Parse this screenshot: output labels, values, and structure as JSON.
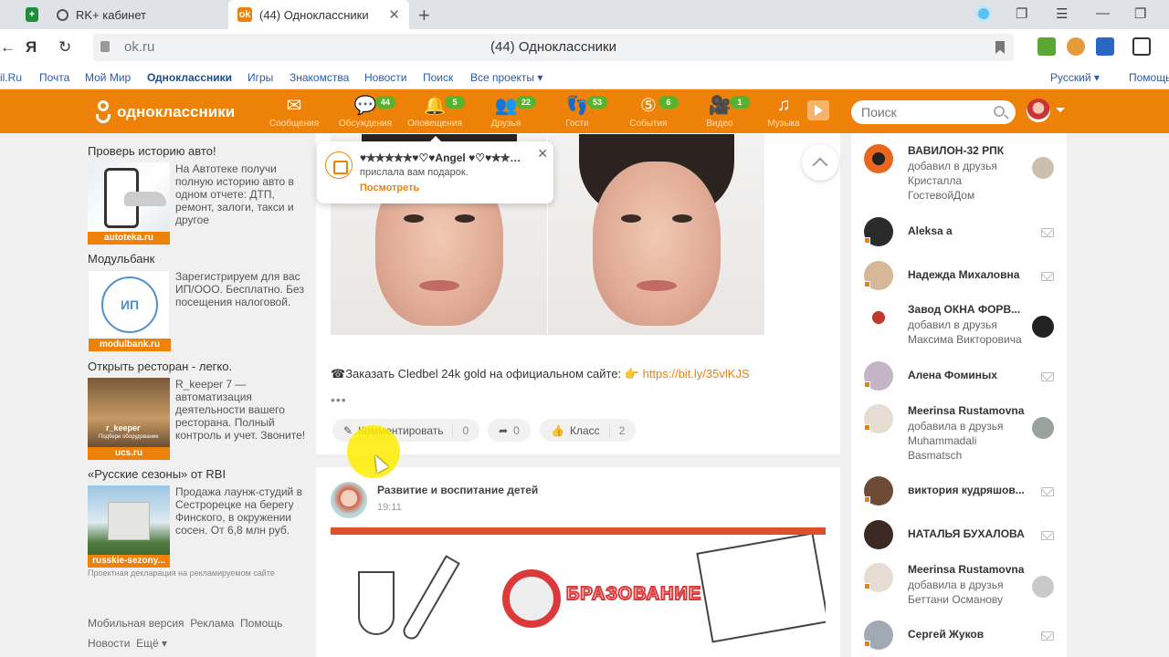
{
  "browser": {
    "tabs": [
      {
        "label": "RK+ кабинет",
        "active": false
      },
      {
        "label": "(44) Одноклассники",
        "active": true
      }
    ],
    "host": "ok.ru",
    "page_title": "(44) Одноклассники",
    "bookmarks_left_stub": "il.Ru",
    "bookmarks": [
      "Почта",
      "Мой Мир",
      "Одноклассники",
      "Игры",
      "Знакомства",
      "Новости",
      "Поиск",
      "Все проекты ▾"
    ],
    "language": "Русский ▾",
    "help": "Помощь"
  },
  "header": {
    "logo": "одноклассники",
    "nav": [
      {
        "label": "Сообщения",
        "icon": "envelope-icon",
        "badge": ""
      },
      {
        "label": "Обсуждения",
        "icon": "chat-bubble-icon",
        "badge": "44"
      },
      {
        "label": "Оповещения",
        "icon": "bell-icon",
        "badge": "5"
      },
      {
        "label": "Друзья",
        "icon": "friends-icon",
        "badge": "22"
      },
      {
        "label": "Гости",
        "icon": "footprints-icon",
        "badge": "53"
      },
      {
        "label": "События",
        "icon": "events-icon",
        "badge": "6"
      },
      {
        "label": "Видео",
        "icon": "video-camera-icon",
        "badge": "1"
      },
      {
        "label": "Музыка",
        "icon": "music-note-icon",
        "badge": ""
      }
    ],
    "search_placeholder": "Поиск",
    "brand_color": "#ee8208",
    "badge_color": "#59b22c"
  },
  "ads": [
    {
      "title": "Проверь историю авто!",
      "text": "На Автотеке получи полную историю авто в одном отчете: ДТП, ремонт, залоги, такси и другое",
      "caption": "autoteka.ru"
    },
    {
      "title": "Модульбанк",
      "text": "Зарегистрируем для вас ИП/ООО. Бесплатно. Без посещения налоговой.",
      "caption": "modulbank.ru",
      "logo_text": "ИП"
    },
    {
      "title": "Открыть ресторан - легко.",
      "text": "R_keeper 7 — автоматизация деятельности вашего ресторана. Полный контроль и учет. Звоните!",
      "caption": "ucs.ru",
      "img_text": "r_keeper",
      "img_sub": "Подбери оборудование"
    },
    {
      "title": "«Русские сезоны» от RBI",
      "text": "Продажа лаунж-студий в Сестрорецке на берегу Финского, в окружении сосен. От 6,8 млн руб.",
      "caption": "russkie-sezony..."
    }
  ],
  "disclaimer": "Проектная декларация на рекламируемом сайте",
  "footer": {
    "row1": [
      "Мобильная версия",
      "Реклама",
      "Помощь"
    ],
    "row2": [
      "Новости",
      "Ещё ▾"
    ]
  },
  "notification": {
    "sender": "♥✯✯✯✯✯♥♡♥Angel ♥♡♥✯✯✯✯...",
    "text": "прислала вам подарок.",
    "action": "Посмотреть"
  },
  "post": {
    "text_prefix": "☎Заказать Cledbel 24k gold на официальном сайте: 👉 ",
    "link": "https://bit.ly/35vlKJS",
    "more": "•••",
    "comment_label": "Комментировать",
    "comment_count": "0",
    "share_count": "0",
    "like_label": "Класс",
    "like_count": "2"
  },
  "post2": {
    "group": "Развитие и воспитание детей",
    "time": "19:11",
    "banner_word": "БРАЗОВАНИЕ"
  },
  "friends": [
    {
      "name": "ВАВИЛОН-32 РПК",
      "sub": "добавил в друзья Кристалла ГостевойДом",
      "type": "thumb"
    },
    {
      "name": "Aleksa a",
      "sub": "",
      "type": "mail"
    },
    {
      "name": "Надежда Михаловна",
      "sub": "",
      "type": "mail"
    },
    {
      "name": "Завод ОКНА ФОРВ...",
      "sub": "добавил в друзья Максима Викторовича",
      "type": "thumb"
    },
    {
      "name": "Алена Фоминых",
      "sub": "",
      "type": "mail"
    },
    {
      "name": "Meerinsa Rustamovna",
      "sub": "добавила в друзья Muhammadali Basmatsch",
      "type": "thumb"
    },
    {
      "name": "виктория кудряшов...",
      "sub": "",
      "type": "mail"
    },
    {
      "name": "НАТАЛЬЯ БУХАЛОВА",
      "sub": "",
      "type": "mail"
    },
    {
      "name": "Meerinsa Rustamovna",
      "sub": "добавила в друзья Беттани Османову",
      "type": "thumb"
    },
    {
      "name": "Сергей Жуков",
      "sub": "",
      "type": "mail"
    }
  ]
}
